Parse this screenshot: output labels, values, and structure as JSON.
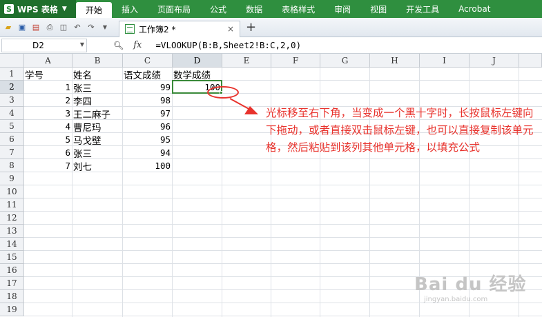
{
  "app": {
    "name": "WPS 表格"
  },
  "menu": [
    "开始",
    "插入",
    "页面布局",
    "公式",
    "数据",
    "表格样式",
    "审阅",
    "视图",
    "开发工具",
    "Acrobat"
  ],
  "active_menu_index": 0,
  "document_tab": {
    "title": "工作簿2 *",
    "close": "×",
    "new": "+"
  },
  "formula_bar": {
    "cell_ref": "D2",
    "fx": "fx",
    "formula": "=VLOOKUP(B:B,Sheet2!B:C,2,0)"
  },
  "columns": [
    "A",
    "B",
    "C",
    "D",
    "E",
    "F",
    "G",
    "H",
    "I",
    "J"
  ],
  "rows": [
    "1",
    "2",
    "3",
    "4",
    "5",
    "6",
    "7",
    "8",
    "9",
    "10",
    "11",
    "12",
    "13",
    "14",
    "15",
    "16",
    "17",
    "18",
    "19"
  ],
  "selected_column": "D",
  "selected_row": "2",
  "table": {
    "headers": [
      "学号",
      "姓名",
      "语文成绩",
      "数学成绩"
    ],
    "rows": [
      {
        "id": "1",
        "name": "张三",
        "chinese": "99",
        "math": "100"
      },
      {
        "id": "2",
        "name": "李四",
        "chinese": "98",
        "math": ""
      },
      {
        "id": "3",
        "name": "王二麻子",
        "chinese": "97",
        "math": ""
      },
      {
        "id": "4",
        "name": "曹尼玛",
        "chinese": "96",
        "math": ""
      },
      {
        "id": "5",
        "name": "马戈壁",
        "chinese": "95",
        "math": ""
      },
      {
        "id": "6",
        "name": "张三",
        "chinese": "94",
        "math": ""
      },
      {
        "id": "7",
        "name": "刘七",
        "chinese": "100",
        "math": ""
      }
    ]
  },
  "annotation": {
    "text": "光标移至右下角，当变成一个黑十字时，长按鼠标左键向下拖动，或者直接双击鼠标左键，也可以直接复制该单元格，然后粘贴到该列其他单元格，以填充公式",
    "color": "#e8322c"
  },
  "watermark": {
    "logo": "Bai du 经验",
    "url": "jingyan.baidu.com"
  },
  "colors": {
    "brand": "#2f8f3f",
    "active_cell": "#3a8a3a"
  }
}
